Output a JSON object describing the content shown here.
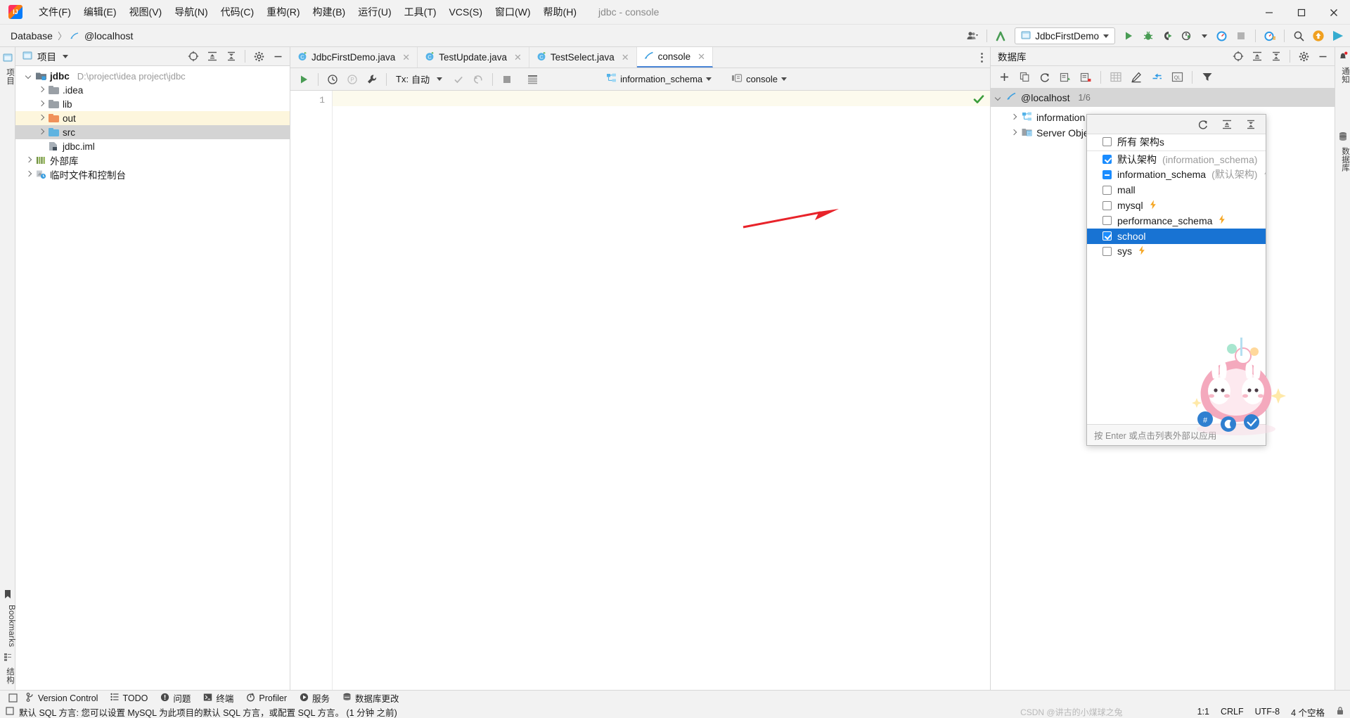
{
  "window": {
    "title": "jdbc - console",
    "controls": {
      "minimize": "─",
      "maximize": "❐",
      "close": "✕"
    }
  },
  "menubar": [
    {
      "label": "文件(F)",
      "name": "menu-file"
    },
    {
      "label": "编辑(E)",
      "name": "menu-edit"
    },
    {
      "label": "视图(V)",
      "name": "menu-view"
    },
    {
      "label": "导航(N)",
      "name": "menu-navigate"
    },
    {
      "label": "代码(C)",
      "name": "menu-code"
    },
    {
      "label": "重构(R)",
      "name": "menu-refactor"
    },
    {
      "label": "构建(B)",
      "name": "menu-build"
    },
    {
      "label": "运行(U)",
      "name": "menu-run"
    },
    {
      "label": "工具(T)",
      "name": "menu-tools"
    },
    {
      "label": "VCS(S)",
      "name": "menu-vcs"
    },
    {
      "label": "窗口(W)",
      "name": "menu-window"
    },
    {
      "label": "帮助(H)",
      "name": "menu-help"
    }
  ],
  "navbar": {
    "breadcrumbs": [
      "Database",
      "@localhost"
    ],
    "separator": "〉",
    "run_config": "JdbcFirstDemo"
  },
  "left_strip": {
    "top_label": "项目",
    "bottom_labels": [
      "结构",
      "Bookmarks"
    ]
  },
  "right_strip": {
    "labels": [
      "通知",
      "数据库"
    ]
  },
  "project_panel": {
    "title": "项目",
    "tree": [
      {
        "label": "jdbc",
        "sub": "D:\\project\\idea project\\jdbc",
        "depth": 0,
        "arrow": "open",
        "icon": "module",
        "bold": true,
        "state": ""
      },
      {
        "label": ".idea",
        "sub": "",
        "depth": 1,
        "arrow": "closed",
        "icon": "folder-grey",
        "bold": false,
        "state": ""
      },
      {
        "label": "lib",
        "sub": "",
        "depth": 1,
        "arrow": "closed",
        "icon": "folder-grey",
        "bold": false,
        "state": ""
      },
      {
        "label": "out",
        "sub": "",
        "depth": 1,
        "arrow": "closed",
        "icon": "folder-orange",
        "bold": false,
        "state": "sel-yellow"
      },
      {
        "label": "src",
        "sub": "",
        "depth": 1,
        "arrow": "closed",
        "icon": "folder-blue",
        "bold": false,
        "state": "sel-grey"
      },
      {
        "label": "jdbc.iml",
        "sub": "",
        "depth": 1,
        "arrow": "blank",
        "icon": "iml",
        "bold": false,
        "state": ""
      },
      {
        "label": "外部库",
        "sub": "",
        "depth": 0,
        "arrow": "closed",
        "icon": "library",
        "bold": false,
        "state": ""
      },
      {
        "label": "临时文件和控制台",
        "sub": "",
        "depth": 0,
        "arrow": "closed",
        "icon": "scratches",
        "bold": false,
        "state": ""
      }
    ]
  },
  "editor": {
    "tabs": [
      {
        "label": "JdbcFirstDemo.java",
        "icon": "java-class-icon",
        "active": false,
        "closeable": true
      },
      {
        "label": "TestUpdate.java",
        "icon": "java-class-icon",
        "active": false,
        "closeable": true
      },
      {
        "label": "TestSelect.java",
        "icon": "java-class-icon",
        "active": false,
        "closeable": true
      },
      {
        "label": "console",
        "icon": "console-icon",
        "active": true,
        "closeable": true
      }
    ],
    "query_toolbar": {
      "tx_label": "Tx:",
      "tx_value": "自动",
      "schema": "information_schema",
      "session": "console"
    },
    "gutter_lines": [
      "1"
    ]
  },
  "database_panel": {
    "title": "数据库",
    "root": {
      "label": "@localhost",
      "count": "1/6"
    },
    "nodes": [
      {
        "label": "information",
        "icon": "schema-icon"
      },
      {
        "label": "Server Obje",
        "icon": "server-objects-icon"
      }
    ],
    "schema_popup": {
      "items": [
        {
          "label": "所有 架构s",
          "suffix": "",
          "state": "unchecked",
          "bolt": false,
          "selected": false,
          "separator_after": true
        },
        {
          "label": "默认架构",
          "suffix": "(information_schema)",
          "state": "checked",
          "bolt": false,
          "selected": false,
          "separator_after": false
        },
        {
          "label": "information_schema",
          "suffix": "(默认架构)",
          "state": "partial",
          "bolt": true,
          "selected": false,
          "separator_after": false
        },
        {
          "label": "mall",
          "suffix": "",
          "state": "unchecked",
          "bolt": false,
          "selected": false,
          "separator_after": false
        },
        {
          "label": "mysql",
          "suffix": "",
          "state": "unchecked",
          "bolt": true,
          "selected": false,
          "separator_after": false
        },
        {
          "label": "performance_schema",
          "suffix": "",
          "state": "unchecked",
          "bolt": true,
          "selected": false,
          "separator_after": false
        },
        {
          "label": "school",
          "suffix": "",
          "state": "checked",
          "bolt": false,
          "selected": true,
          "separator_after": false
        },
        {
          "label": "sys",
          "suffix": "",
          "state": "unchecked",
          "bolt": true,
          "selected": false,
          "separator_after": false
        }
      ],
      "footer_hint": "按 Enter 或点击列表外部以应用"
    }
  },
  "bottom_tools": [
    {
      "label": "Version Control",
      "icon": "branch-icon"
    },
    {
      "label": "TODO",
      "icon": "todo-icon"
    },
    {
      "label": "问题",
      "icon": "problems-icon"
    },
    {
      "label": "终端",
      "icon": "terminal-icon"
    },
    {
      "label": "Profiler",
      "icon": "profiler-icon"
    },
    {
      "label": "服务",
      "icon": "services-icon"
    },
    {
      "label": "数据库更改",
      "icon": "db-changes-icon"
    }
  ],
  "statusbar": {
    "message": "默认 SQL 方言: 您可以设置 MySQL 为此项目的默认 SQL 方言，或配置 SQL 方言。 (1 分钟 之前)",
    "caret": "1:1",
    "line_sep": "CRLF",
    "encoding": "UTF-8",
    "indent": "4 个空格",
    "watermark": "CSDN @讲古的小煤球之兔"
  },
  "colors": {
    "accent_blue": "#1873d3",
    "selection_yellow": "#fdf6dd",
    "selection_grey": "#d4d4d4",
    "run_green": "#499c54",
    "bolt_orange": "#f5a623",
    "arrow_red": "#e8232a"
  }
}
